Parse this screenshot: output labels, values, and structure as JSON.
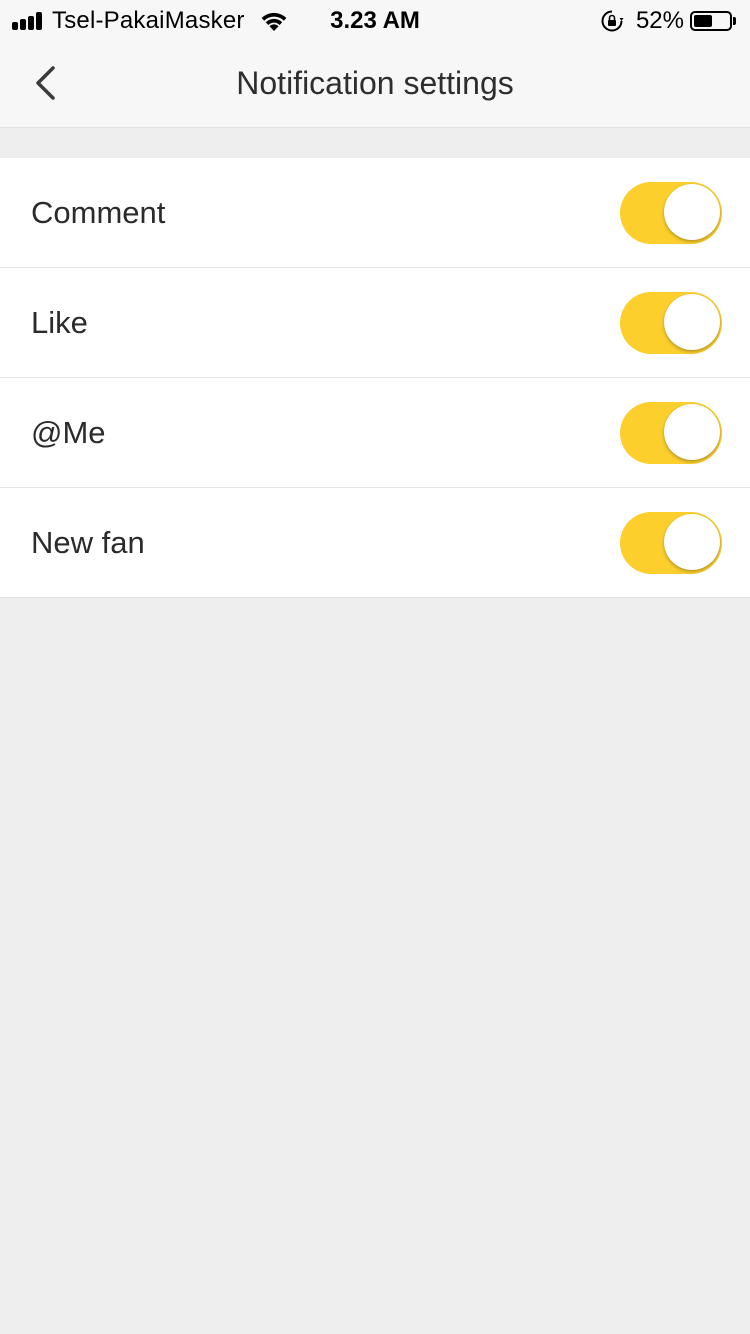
{
  "status_bar": {
    "carrier": "Tsel-PakaiMasker",
    "time": "3.23 AM",
    "battery_percent": "52%",
    "battery_level": 0.52,
    "signal_icon": "signal-bars-icon",
    "wifi_icon": "wifi-icon",
    "rotation_lock_icon": "rotation-lock-icon",
    "battery_icon": "battery-icon"
  },
  "nav": {
    "title": "Notification settings",
    "back_icon": "chevron-left-icon"
  },
  "settings": {
    "items": [
      {
        "label": "Comment",
        "enabled": true
      },
      {
        "label": "Like",
        "enabled": true
      },
      {
        "label": "@Me",
        "enabled": true
      },
      {
        "label": "New fan",
        "enabled": true
      }
    ]
  },
  "colors": {
    "toggle_on": "#fccf2c",
    "background": "#eeeeee",
    "header": "#f7f7f7"
  }
}
